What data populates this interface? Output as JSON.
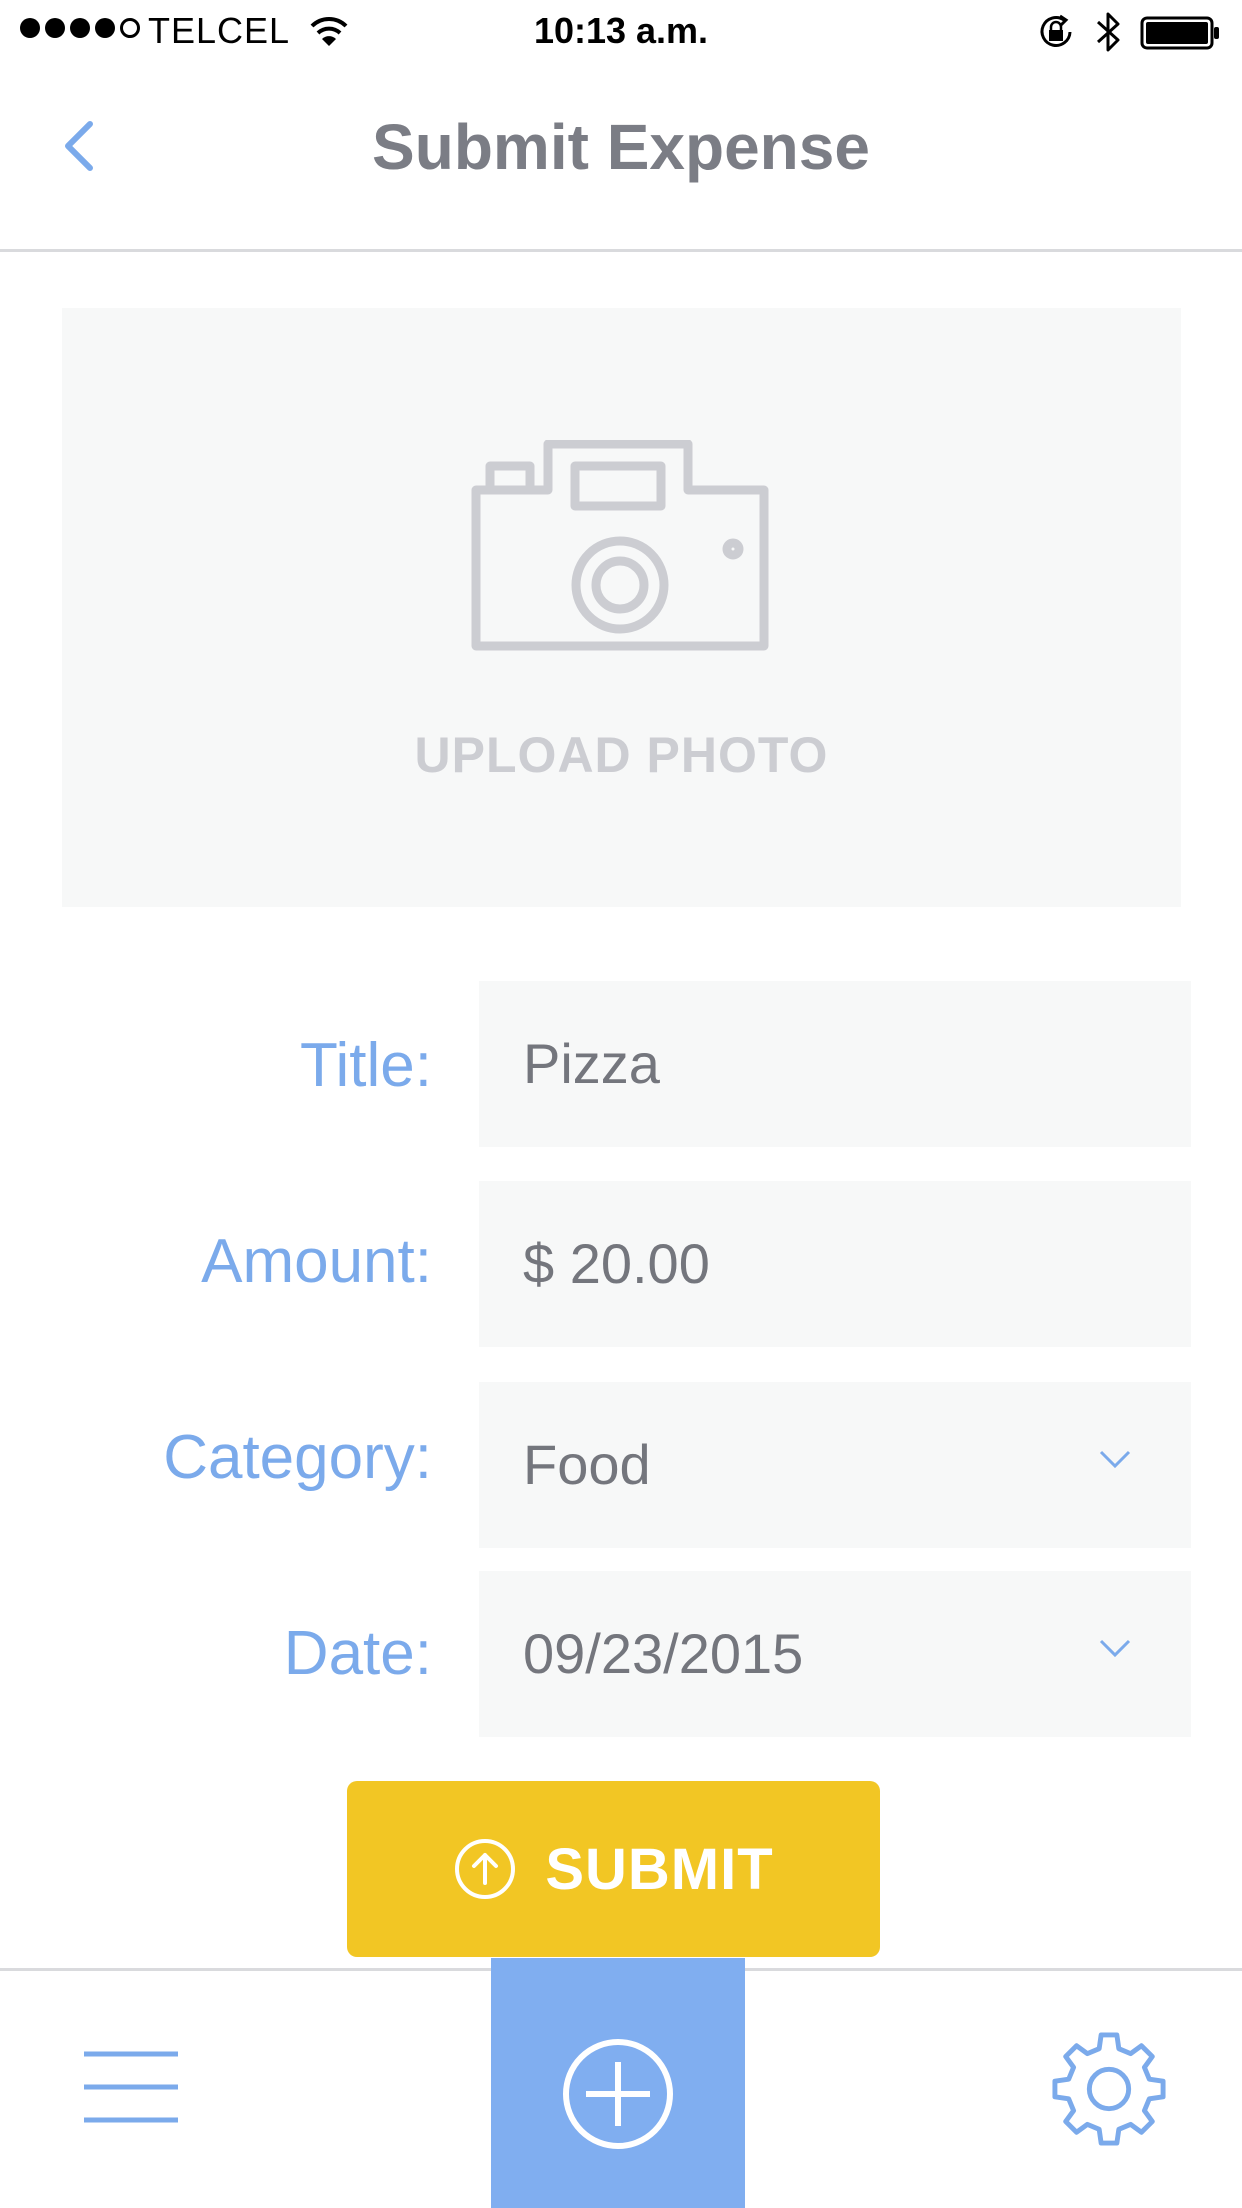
{
  "status_bar": {
    "carrier": "TELCEL",
    "time": "10:13 a.m.",
    "signal_bars_filled": 4,
    "signal_bars_total": 5
  },
  "nav": {
    "title": "Submit Expense",
    "back_icon": "chevron-left-icon"
  },
  "upload": {
    "label": "UPLOAD PHOTO",
    "icon": "camera-icon"
  },
  "form": {
    "title_label": "Title:",
    "title_value": "Pizza",
    "amount_label": "Amount:",
    "amount_value": "$ 20.00",
    "category_label": "Category:",
    "category_value": "Food",
    "date_label": "Date:",
    "date_value": "09/23/2015"
  },
  "submit": {
    "label": "SUBMIT",
    "icon": "arrow-up-circle-icon"
  },
  "tab_bar": {
    "menu_icon": "hamburger-menu-icon",
    "add_icon": "plus-circle-icon",
    "settings_icon": "gear-icon"
  },
  "colors": {
    "accent_blue": "#7baaeb",
    "add_button_blue": "#80aef0",
    "submit_yellow": "#f2c624",
    "title_gray": "#7b7d85",
    "field_background": "#f7f8f8",
    "placeholder_gray": "#cccdd2"
  }
}
